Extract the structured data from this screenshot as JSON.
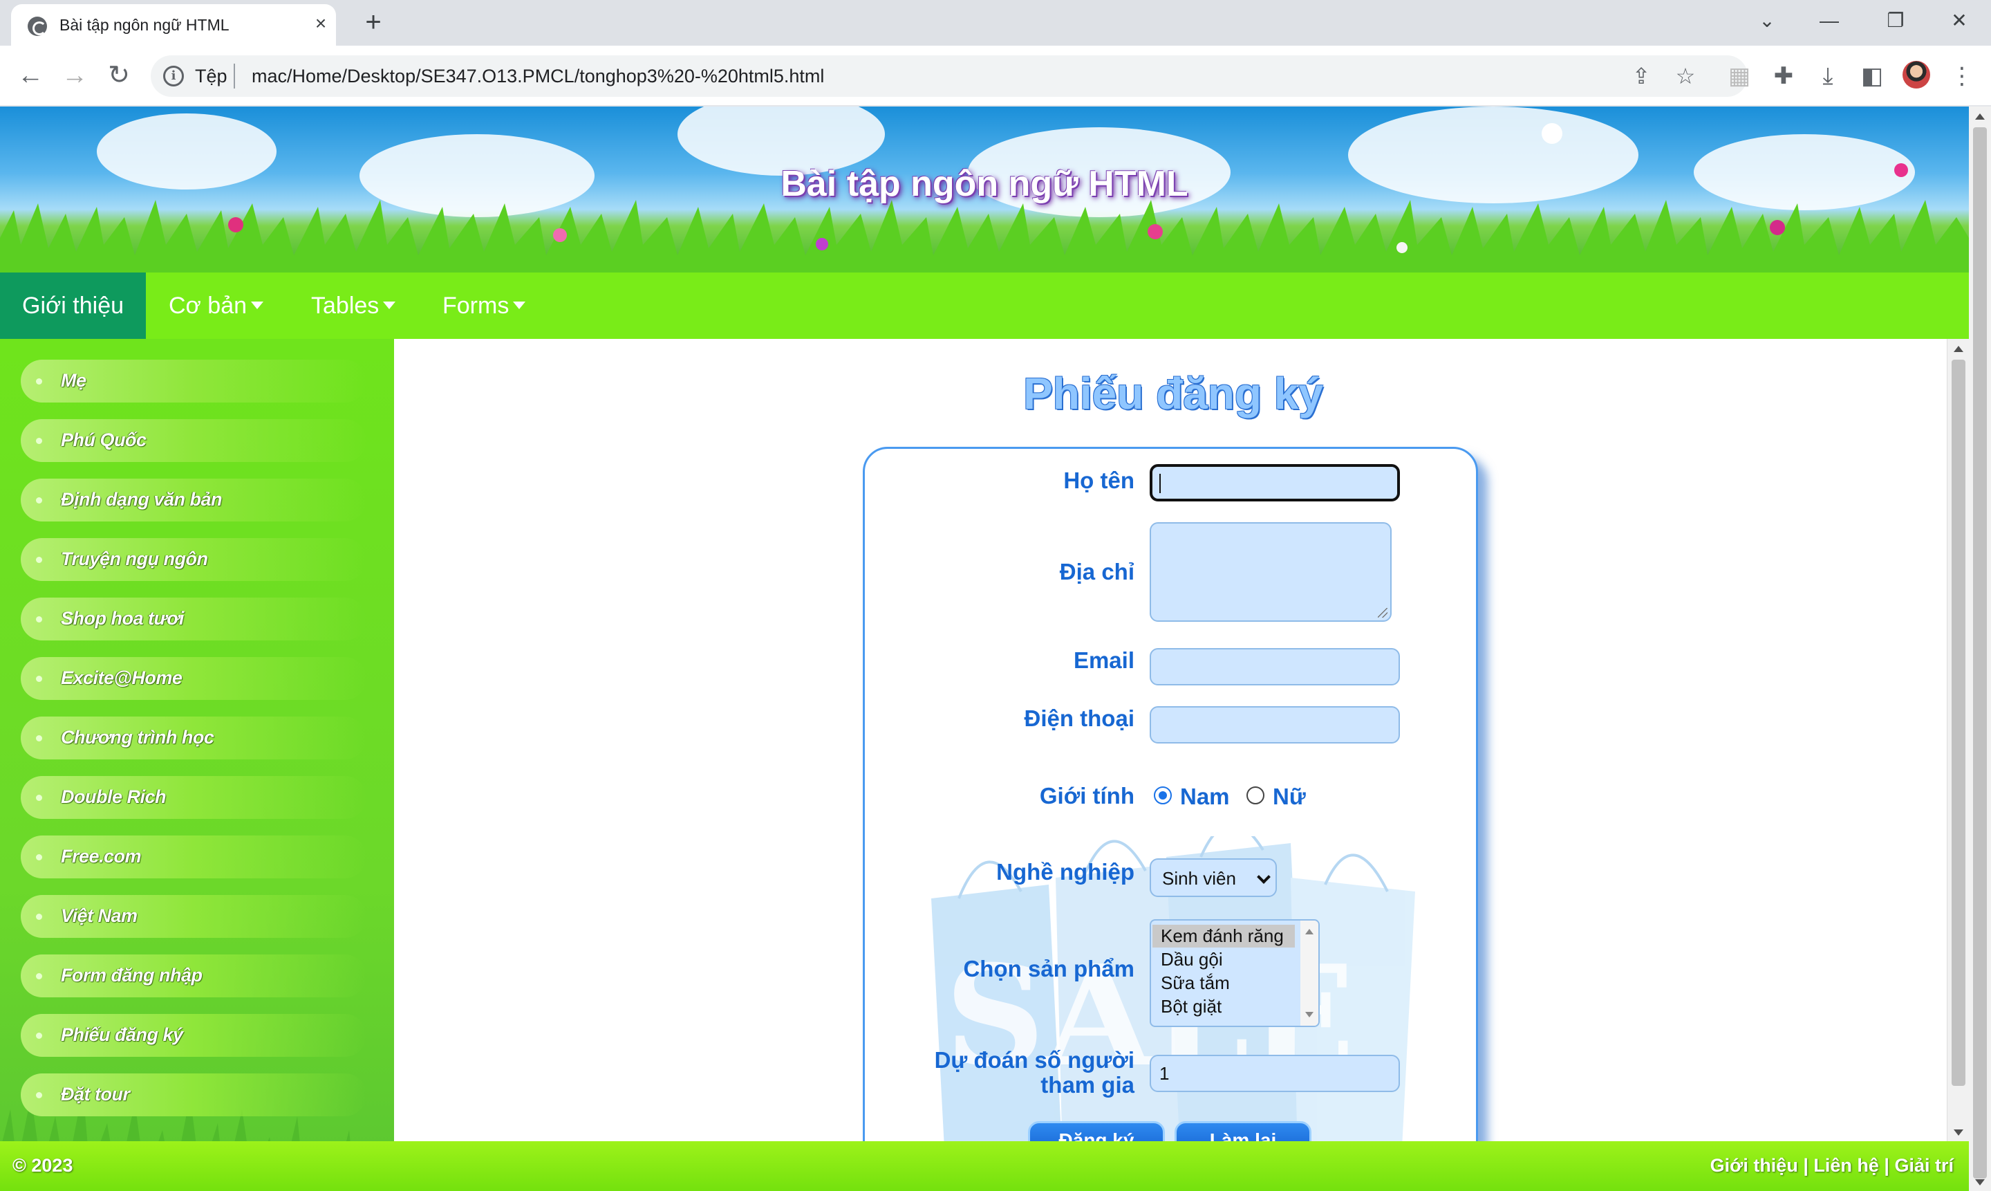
{
  "browser": {
    "tab_title": "Bài tập ngôn ngữ HTML",
    "tab_close": "×",
    "new_tab": "+",
    "window_controls": [
      "⌄",
      "—",
      "❐",
      "✕"
    ],
    "address_prefix": "Tệp",
    "url": "mac/Home/Desktop/SE347.O13.PMCL/tonghop3%20-%20html5.html",
    "icons": [
      "back-icon",
      "forward-icon",
      "reload-icon",
      "info-icon",
      "share-icon",
      "star-icon",
      "extension-icon",
      "puzzle-icon",
      "download-icon",
      "sidepanel-icon",
      "profile-avatar",
      "menu-icon"
    ]
  },
  "header": {
    "title": "Bài tập ngôn ngữ HTML"
  },
  "nav": {
    "items": [
      {
        "label": "Giới thiệu",
        "active": true,
        "dropdown": false
      },
      {
        "label": "Cơ bản",
        "active": false,
        "dropdown": true
      },
      {
        "label": "Tables",
        "active": false,
        "dropdown": true
      },
      {
        "label": "Forms",
        "active": false,
        "dropdown": true
      }
    ]
  },
  "sidebar": {
    "items": [
      "Mẹ",
      "Phú Quốc",
      "Định dạng văn bản",
      "Truyện ngụ ngôn",
      "Shop hoa tươi",
      "Excite@Home",
      "Chương trình học",
      "Double Rich",
      "Free.com",
      "Việt Nam",
      "Form đăng nhập",
      "Phiếu đăng ký",
      "Đặt tour"
    ]
  },
  "form": {
    "title": "Phiếu đăng ký",
    "labels": {
      "name": "Họ tên",
      "address": "Địa chỉ",
      "email": "Email",
      "phone": "Điện thoại",
      "gender": "Giới tính",
      "job": "Nghề nghiệp",
      "products": "Chọn sản phẩm",
      "guess_line1": "Dự đoán số người",
      "guess_line2": "tham gia"
    },
    "values": {
      "name": "",
      "address": "",
      "email": "",
      "phone": "",
      "guess": "1"
    },
    "gender_options": [
      "Nam",
      "Nữ"
    ],
    "gender_selected": "Nam",
    "job_selected": "Sinh viên",
    "product_options": [
      "Kem đánh răng",
      "Dầu gội",
      "Sữa tắm",
      "Bột giặt"
    ],
    "product_highlighted": "Kem đánh răng",
    "buttons": {
      "submit": "Đăng ký",
      "reset": "Làm lại"
    },
    "background_art": "SALE"
  },
  "footer": {
    "copyright": "© 2023",
    "links": [
      "Giới thiệu",
      "Liên hệ",
      "Giải trí"
    ],
    "separator": " | "
  },
  "colors": {
    "nav_bg": "#79ec18",
    "nav_active": "#0e9a5d",
    "label_blue": "#1767d2",
    "input_bg": "#cfe6ff",
    "title_blue": "#8fc6ff"
  }
}
